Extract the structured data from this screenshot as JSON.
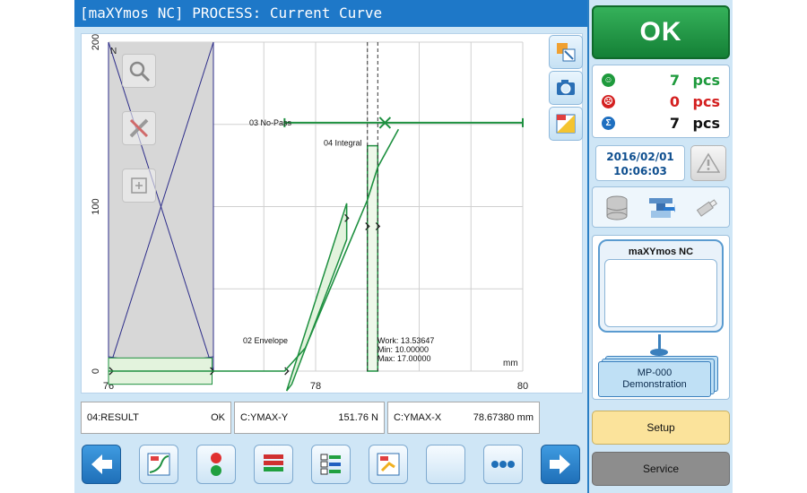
{
  "window": {
    "title": "[maXYmos NC] PROCESS: Current Curve"
  },
  "chart_data": {
    "type": "line",
    "xlim": [
      76,
      80
    ],
    "ylim": [
      0,
      200
    ],
    "x_ticks": [
      "76",
      "78",
      "80"
    ],
    "y_ticks": [
      "0",
      "100",
      "200"
    ],
    "y_unit_label": "N",
    "x_unit_label": "mm",
    "grid": true,
    "curve": {
      "x": [
        76.0,
        77.0,
        77.7,
        77.9,
        78.1,
        78.3,
        78.5,
        78.6,
        78.8
      ],
      "y": [
        0,
        0,
        0,
        14,
        44,
        74,
        104,
        124,
        147
      ]
    },
    "evaluation_objects": [
      {
        "label": "02 Envelope",
        "x_min": 77.72,
        "x_max": 78.3,
        "y_min": -12,
        "y_max": 110
      },
      {
        "label": "03 No-Pass",
        "x_min": 77.7,
        "x_max": 80.0,
        "y": 151
      },
      {
        "label": "04 Integral",
        "x_min": 78.5,
        "x_max": 78.6,
        "y_min": 0,
        "y_max": 137
      }
    ],
    "integral_info": [
      "Work: 13.53647",
      "Min: 10.00000",
      "Max: 17.00000"
    ]
  },
  "results": {
    "r1": {
      "label": "04:RESULT",
      "value": "OK"
    },
    "r2": {
      "label": "C:YMAX-Y",
      "value": "151.76 N"
    },
    "r3": {
      "label": "C:YMAX-X",
      "value": "78.67380 mm"
    }
  },
  "status": {
    "result": "OK",
    "counts": [
      {
        "value": "7",
        "unit": "pcs",
        "color": "#1e9a3c"
      },
      {
        "value": "0",
        "unit": "pcs",
        "color": "#d42020"
      },
      {
        "value": "7",
        "unit": "pcs",
        "color": "#111111"
      }
    ],
    "date": "2016/02/01",
    "time": "10:06:03"
  },
  "device": {
    "name": "maXYmos NC",
    "mp_line1": "MP-000",
    "mp_line2": "Demonstration"
  },
  "buttons": {
    "setup": "Setup",
    "service": "Service"
  },
  "colors": {
    "curve": "#1e9040",
    "axis_lines": "#2d2d8a",
    "ok_green": "#1e9a3c",
    "title_blue": "#1e78c8"
  }
}
